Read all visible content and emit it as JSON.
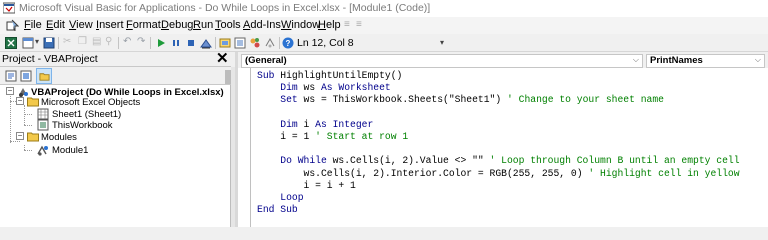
{
  "window": {
    "title": "Microsoft Visual Basic for Applications - Do While Loops in Excel.xlsx - [Module1 (Code)]"
  },
  "menu": {
    "items": [
      "File",
      "Edit",
      "View",
      "Insert",
      "Format",
      "Debug",
      "Run",
      "Tools",
      "Add-Ins",
      "Window",
      "Help"
    ]
  },
  "toolbar": {
    "status": "Ln 12, Col 8"
  },
  "project_pane": {
    "title": "Project - VBAProject",
    "close_glyph": "✕",
    "tree": {
      "project": "VBAProject (Do While Loops in Excel.xlsx)",
      "excel_objects": "Microsoft Excel Objects",
      "sheet1": "Sheet1 (Sheet1)",
      "workbook": "ThisWorkbook",
      "modules": "Modules",
      "module1": "Module1"
    }
  },
  "code_window": {
    "object_combo": "(General)",
    "procedure_combo": "PrintNames",
    "lines": [
      [
        {
          "t": "Sub ",
          "c": "kw"
        },
        {
          "t": "HighlightUntilEmpty()",
          "c": ""
        }
      ],
      [
        {
          "t": "    Dim ",
          "c": "kw"
        },
        {
          "t": "ws ",
          "c": ""
        },
        {
          "t": "As ",
          "c": "kw"
        },
        {
          "t": "Worksheet",
          "c": "kw"
        }
      ],
      [
        {
          "t": "    Set ",
          "c": "kw"
        },
        {
          "t": "ws = ThisWorkbook.Sheets(\"Sheet1\") ",
          "c": ""
        },
        {
          "t": "' Change to your sheet name",
          "c": "cm"
        }
      ],
      [
        {
          "t": "",
          "c": ""
        }
      ],
      [
        {
          "t": "    Dim ",
          "c": "kw"
        },
        {
          "t": "i ",
          "c": ""
        },
        {
          "t": "As ",
          "c": "kw"
        },
        {
          "t": "Integer",
          "c": "kw"
        }
      ],
      [
        {
          "t": "    i = 1 ",
          "c": ""
        },
        {
          "t": "' Start at row 1",
          "c": "cm"
        }
      ],
      [
        {
          "t": "",
          "c": ""
        }
      ],
      [
        {
          "t": "    Do While ",
          "c": "kw"
        },
        {
          "t": "ws.Cells(i, 2).Value <> \"\" ",
          "c": ""
        },
        {
          "t": "' Loop through Column B until an empty cell",
          "c": "cm"
        }
      ],
      [
        {
          "t": "        ws.Cells(i, 2).Interior.Color = RGB(255, 255, 0) ",
          "c": ""
        },
        {
          "t": "' Highlight cell in yellow",
          "c": "cm"
        }
      ],
      [
        {
          "t": "        i = i + 1",
          "c": ""
        }
      ],
      [
        {
          "t": "    Loop",
          "c": "kw"
        }
      ],
      [
        {
          "t": "End Sub",
          "c": "kw"
        }
      ]
    ]
  },
  "icons": {
    "app": "vba-app-icon",
    "excel": "excel-icon",
    "save": "save-icon",
    "run": "run-icon",
    "pause": "break-icon",
    "stop": "reset-icon",
    "design": "design-mode-icon",
    "project_explorer": "project-explorer-icon",
    "properties": "properties-icon",
    "object_browser": "object-browser-icon",
    "toolbox": "toolbox-icon",
    "help": "help-icon",
    "view_code": "view-code-icon",
    "view_object": "view-object-icon",
    "toggle_folders": "toggle-folders-icon",
    "project_node": "vba-project-icon",
    "folder": "folder-icon",
    "sheet": "worksheet-icon",
    "workbook": "workbook-icon",
    "module": "module-icon"
  }
}
